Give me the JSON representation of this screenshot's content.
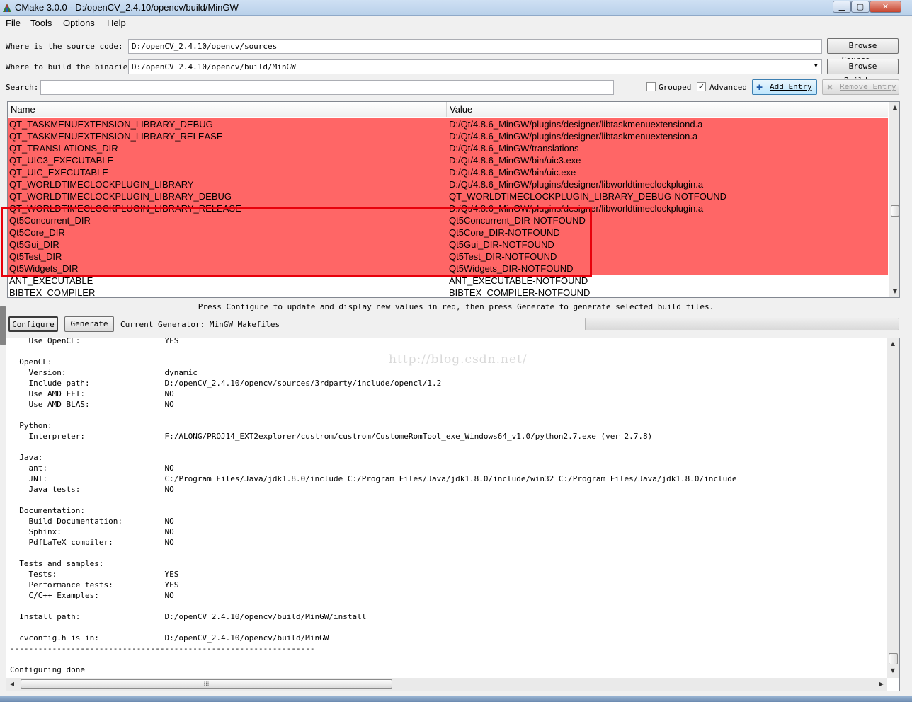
{
  "window": {
    "title": "CMake 3.0.0 - D:/openCV_2.4.10/opencv/build/MinGW"
  },
  "menu": [
    "File",
    "Tools",
    "Options",
    "Help"
  ],
  "source": {
    "label": "Where is the source code:",
    "value": "D:/openCV_2.4.10/opencv/sources",
    "browse_label": "Browse Source..."
  },
  "build": {
    "label": "Where to build the binaries:",
    "value": "D:/openCV_2.4.10/opencv/build/MinGW",
    "browse_label": "Browse Build..."
  },
  "search": {
    "label": "Search:",
    "value": ""
  },
  "options": {
    "grouped_label": "Grouped",
    "grouped_checked": false,
    "advanced_label": "Advanced",
    "advanced_checked": true,
    "add_entry_label": "Add Entry",
    "remove_entry_label": "Remove Entry"
  },
  "table": {
    "headers": [
      "Name",
      "Value"
    ],
    "rows": [
      {
        "name": "QT_TASKMENUEXTENSION_LIBRARY_DEBUG",
        "value": "D:/Qt/4.8.6_MinGW/plugins/designer/libtaskmenuextensiond.a",
        "new": true
      },
      {
        "name": "QT_TASKMENUEXTENSION_LIBRARY_RELEASE",
        "value": "D:/Qt/4.8.6_MinGW/plugins/designer/libtaskmenuextension.a",
        "new": true
      },
      {
        "name": "QT_TRANSLATIONS_DIR",
        "value": "D:/Qt/4.8.6_MinGW/translations",
        "new": true
      },
      {
        "name": "QT_UIC3_EXECUTABLE",
        "value": "D:/Qt/4.8.6_MinGW/bin/uic3.exe",
        "new": true
      },
      {
        "name": "QT_UIC_EXECUTABLE",
        "value": "D:/Qt/4.8.6_MinGW/bin/uic.exe",
        "new": true
      },
      {
        "name": "QT_WORLDTIMECLOCKPLUGIN_LIBRARY",
        "value": "D:/Qt/4.8.6_MinGW/plugins/designer/libworldtimeclockplugin.a",
        "new": true
      },
      {
        "name": "QT_WORLDTIMECLOCKPLUGIN_LIBRARY_DEBUG",
        "value": "QT_WORLDTIMECLOCKPLUGIN_LIBRARY_DEBUG-NOTFOUND",
        "new": true
      },
      {
        "name": "QT_WORLDTIMECLOCKPLUGIN_LIBRARY_RELEASE",
        "value": "D:/Qt/4.8.6_MinGW/plugins/designer/libworldtimeclockplugin.a",
        "new": true
      },
      {
        "name": "Qt5Concurrent_DIR",
        "value": "Qt5Concurrent_DIR-NOTFOUND",
        "new": true
      },
      {
        "name": "Qt5Core_DIR",
        "value": "Qt5Core_DIR-NOTFOUND",
        "new": true
      },
      {
        "name": "Qt5Gui_DIR",
        "value": "Qt5Gui_DIR-NOTFOUND",
        "new": true
      },
      {
        "name": "Qt5Test_DIR",
        "value": "Qt5Test_DIR-NOTFOUND",
        "new": true
      },
      {
        "name": "Qt5Widgets_DIR",
        "value": "Qt5Widgets_DIR-NOTFOUND",
        "new": true
      },
      {
        "name": "ANT_EXECUTABLE",
        "value": "ANT_EXECUTABLE-NOTFOUND",
        "new": false
      },
      {
        "name": "BIBTEX_COMPILER",
        "value": "BIBTEX_COMPILER-NOTFOUND",
        "new": false
      }
    ]
  },
  "hint": "Press Configure to update and display new values in red, then press Generate to generate selected build files.",
  "actions": {
    "configure_label": "Configure",
    "generate_label": "Generate",
    "generator_text": "Current Generator: MinGW Makefiles"
  },
  "watermark": "http://blog.csdn.net/",
  "output": "    Use OpenCL:                  YES\n\n  OpenCL:\n    Version:                     dynamic\n    Include path:                D:/openCV_2.4.10/opencv/sources/3rdparty/include/opencl/1.2\n    Use AMD FFT:                 NO\n    Use AMD BLAS:                NO\n\n  Python:\n    Interpreter:                 F:/ALONG/PROJ14_EXT2explorer/custrom/custrom/CustomeRomTool_exe_Windows64_v1.0/python2.7.exe (ver 2.7.8)\n\n  Java:\n    ant:                         NO\n    JNI:                         C:/Program Files/Java/jdk1.8.0/include C:/Program Files/Java/jdk1.8.0/include/win32 C:/Program Files/Java/jdk1.8.0/include\n    Java tests:                  NO\n\n  Documentation:\n    Build Documentation:         NO\n    Sphinx:                      NO\n    PdfLaTeX compiler:           NO\n\n  Tests and samples:\n    Tests:                       YES\n    Performance tests:           YES\n    C/C++ Examples:              NO\n\n  Install path:                  D:/openCV_2.4.10/opencv/build/MinGW/install\n\n  cvconfig.h is in:              D:/openCV_2.4.10/opencv/build/MinGW\n-----------------------------------------------------------------\n\nConfiguring done",
  "colors": {
    "new_row": "#ff6666",
    "highlight_box": "#e8000b"
  }
}
